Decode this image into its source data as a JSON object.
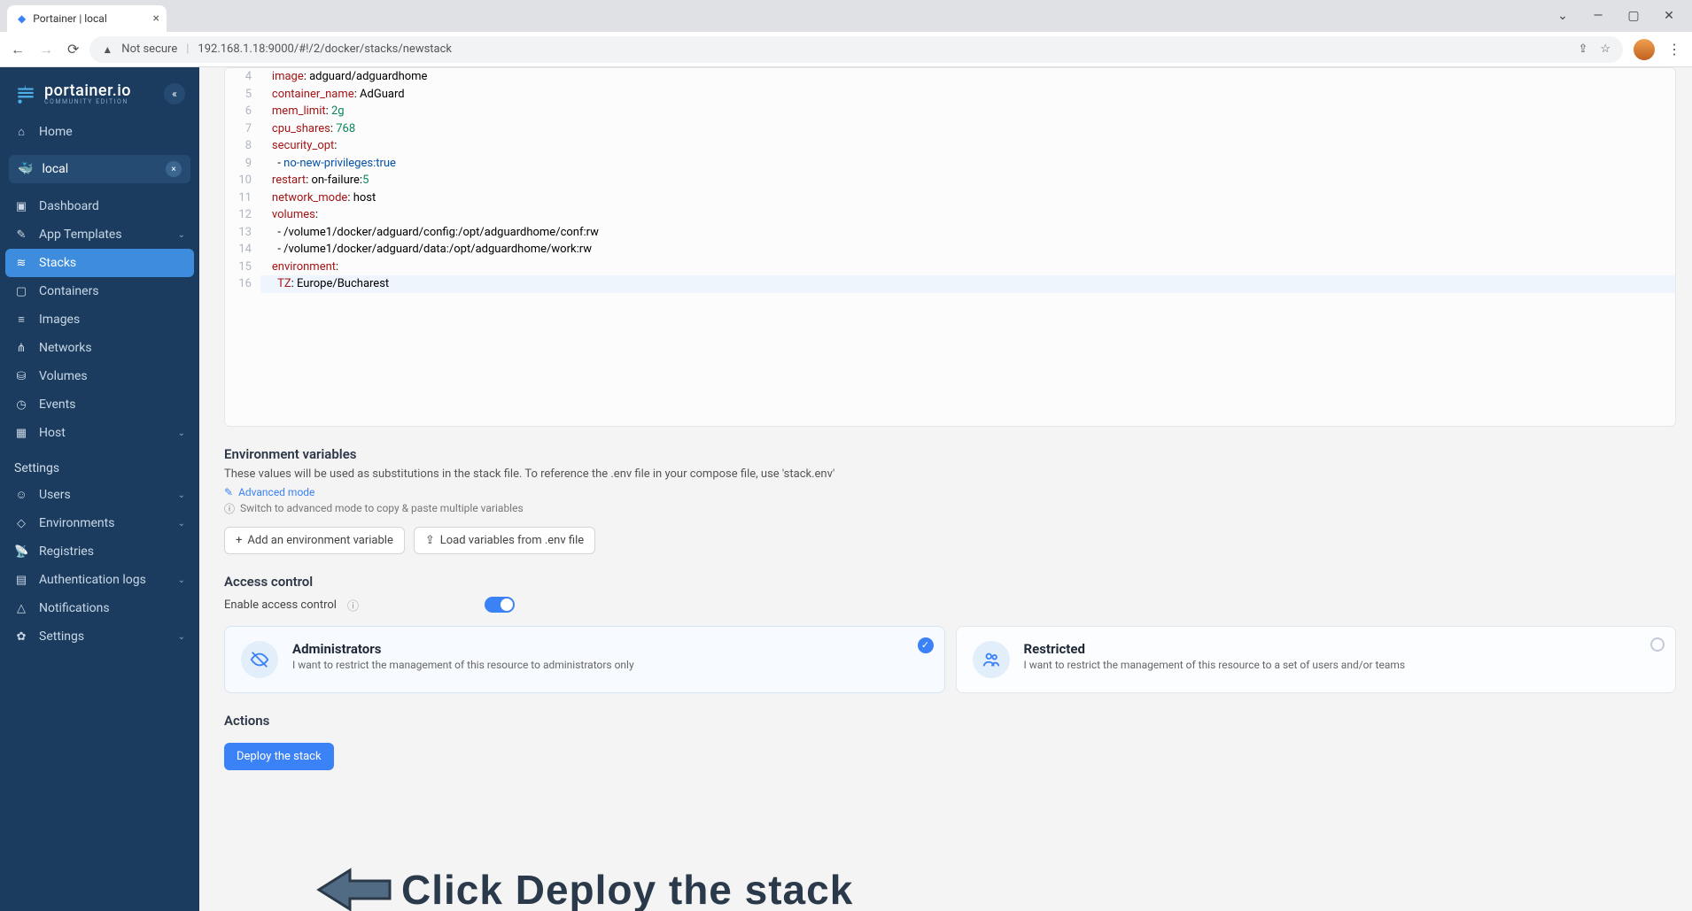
{
  "browser": {
    "tab_title": "Portainer | local",
    "not_secure": "Not secure",
    "url": "192.168.1.18:9000/#!/2/docker/stacks/newstack"
  },
  "sidebar": {
    "brand": "portainer.io",
    "brand_sub": "COMMUNITY EDITION",
    "home": "Home",
    "env_name": "local",
    "items": [
      {
        "label": "Dashboard",
        "icon": "▣"
      },
      {
        "label": "App Templates",
        "icon": "✎",
        "chevron": true
      },
      {
        "label": "Stacks",
        "icon": "≋",
        "active": true
      },
      {
        "label": "Containers",
        "icon": "▢"
      },
      {
        "label": "Images",
        "icon": "≡"
      },
      {
        "label": "Networks",
        "icon": "⋔"
      },
      {
        "label": "Volumes",
        "icon": "⛁"
      },
      {
        "label": "Events",
        "icon": "◷"
      },
      {
        "label": "Host",
        "icon": "▦",
        "chevron": true
      }
    ],
    "settings_label": "Settings",
    "settings_items": [
      {
        "label": "Users",
        "icon": "☺",
        "chevron": true
      },
      {
        "label": "Environments",
        "icon": "◇",
        "chevron": true
      },
      {
        "label": "Registries",
        "icon": "📡"
      },
      {
        "label": "Authentication logs",
        "icon": "▤",
        "chevron": true
      },
      {
        "label": "Notifications",
        "icon": "△"
      },
      {
        "label": "Settings",
        "icon": "✿",
        "chevron": true
      }
    ]
  },
  "editor": {
    "lines": [
      {
        "n": 4,
        "html": "    <span class='tok-key'>image</span>: adguard/adguardhome"
      },
      {
        "n": 5,
        "html": "    <span class='tok-key'>container_name</span>: AdGuard"
      },
      {
        "n": 6,
        "html": "    <span class='tok-key'>mem_limit</span>: <span class='tok-num'>2g</span>"
      },
      {
        "n": 7,
        "html": "    <span class='tok-key'>cpu_shares</span>: <span class='tok-num'>768</span>"
      },
      {
        "n": 8,
        "html": "    <span class='tok-key'>security_opt</span>:"
      },
      {
        "n": 9,
        "html": "      - <span class='tok-str'>no-new-privileges:true</span>"
      },
      {
        "n": 10,
        "html": "    <span class='tok-key'>restart</span>: on-failure:<span class='tok-num'>5</span>"
      },
      {
        "n": 11,
        "html": "    <span class='tok-key'>network_mode</span>: host"
      },
      {
        "n": 12,
        "html": "    <span class='tok-key'>volumes</span>:"
      },
      {
        "n": 13,
        "html": "      - /volume1/docker/adguard/config:/opt/adguardhome/conf:rw"
      },
      {
        "n": 14,
        "html": "      - /volume1/docker/adguard/data:/opt/adguardhome/work:rw"
      },
      {
        "n": 15,
        "html": "    <span class='tok-key'>environment</span>:"
      },
      {
        "n": 16,
        "html": "      <span class='tok-key'>TZ</span>: Europe/Bucharest",
        "hl": true
      }
    ]
  },
  "env_vars": {
    "title": "Environment variables",
    "help": "These values will be used as substitutions in the stack file. To reference the .env file in your compose file, use 'stack.env'",
    "advanced_link": "Advanced mode",
    "switch_info": "Switch to advanced mode to copy & paste multiple variables",
    "add_btn": "Add an environment variable",
    "load_btn": "Load variables from .env file"
  },
  "access": {
    "title": "Access control",
    "enable_label": "Enable access control",
    "admin_title": "Administrators",
    "admin_desc": "I want to restrict the management of this resource to administrators only",
    "restricted_title": "Restricted",
    "restricted_desc": "I want to restrict the management of this resource to a set of users and/or teams"
  },
  "actions": {
    "title": "Actions",
    "deploy_btn": "Deploy the stack"
  },
  "annotation": {
    "text": "Click Deploy the stack"
  }
}
